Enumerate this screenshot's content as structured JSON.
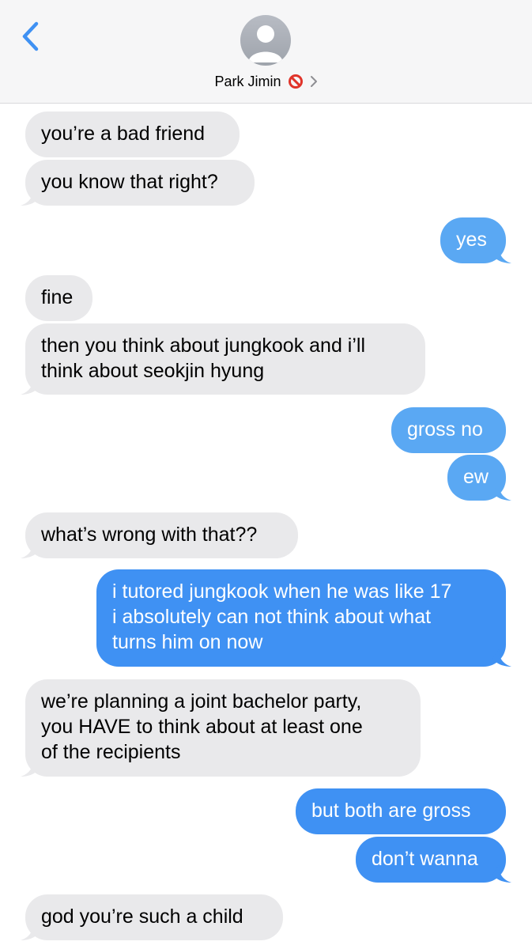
{
  "header": {
    "contact_name": "Park Jimin",
    "icons": {
      "back": "chevron-left-icon",
      "avatar": "person-placeholder-icon",
      "status": "prohibited-emoji-icon",
      "detail": "chevron-right-icon"
    },
    "accent_color": "#3f91f3"
  },
  "messages": [
    {
      "from": "them",
      "text": "you’re a bad friend"
    },
    {
      "from": "them",
      "text": "you know that right?"
    },
    {
      "from": "me",
      "text": "yes"
    },
    {
      "from": "them",
      "text": "fine"
    },
    {
      "from": "them",
      "lines": [
        "then you think about jungkook and i’ll",
        "think about seokjin hyung"
      ]
    },
    {
      "from": "me",
      "text": "gross no"
    },
    {
      "from": "me",
      "text": "ew"
    },
    {
      "from": "them",
      "text": "what’s wrong with that??"
    },
    {
      "from": "me",
      "lines": [
        "i tutored jungkook when he was like 17",
        "i absolutely can not think about what",
        "turns him on now"
      ]
    },
    {
      "from": "them",
      "lines": [
        "we’re planning a joint bachelor party,",
        "you HAVE to think about at least one",
        "of the recipients"
      ]
    },
    {
      "from": "me",
      "text": "but both are gross"
    },
    {
      "from": "me",
      "text": "don’t wanna"
    },
    {
      "from": "them",
      "text": "god you’re such a child"
    }
  ],
  "colors": {
    "incoming_bubble": "#e9e9eb",
    "outgoing_bubble": "#3f91f3",
    "outgoing_bubble_light": "#5aa8f3"
  }
}
